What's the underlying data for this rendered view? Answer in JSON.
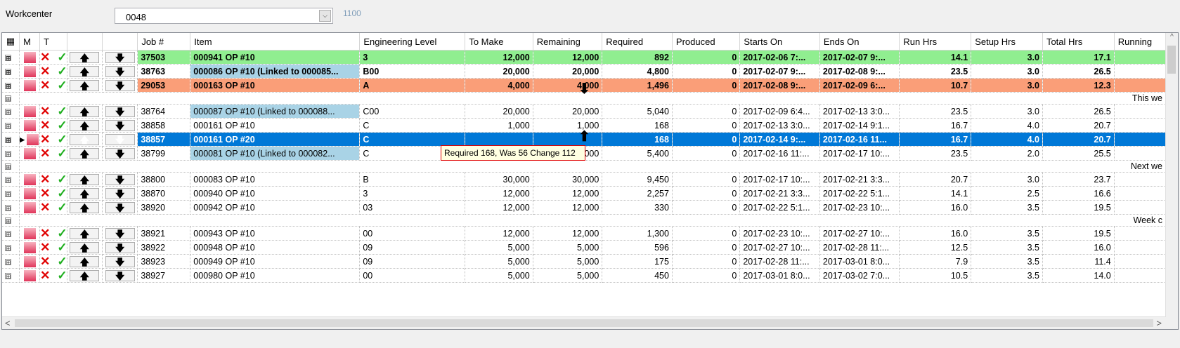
{
  "workcenter": {
    "label": "Workcenter",
    "value": "0048",
    "dropdown_icon": "chevron-down-icon",
    "sub_value": "1100"
  },
  "columns": [
    "",
    "M",
    "T",
    "",
    "",
    "Job #",
    "Item",
    "Engineering Level",
    "To Make",
    "Remaining",
    "Required",
    "Produced",
    "Starts On",
    "Ends On",
    "Run Hrs",
    "Setup Hrs",
    "Total Hrs",
    "Running"
  ],
  "rows": [
    {
      "style": "green",
      "job": "37503",
      "item": "000941 OP #10",
      "eng": "3",
      "to_make": "12,000",
      "remaining": "12,000",
      "required": "892",
      "produced": "0",
      "starts": "2017-02-06 7:...",
      "ends": "2017-02-07 9:...",
      "run": "14.1",
      "setup": "3.0",
      "total": "17.1"
    },
    {
      "style": "white-b",
      "job": "38763",
      "item": "000086 OP #10 (Linked to 000085...",
      "eng": "B00",
      "to_make": "20,000",
      "remaining": "20,000",
      "required": "4,800",
      "produced": "0",
      "starts": "2017-02-07 9:...",
      "ends": "2017-02-08 9:...",
      "run": "23.5",
      "setup": "3.0",
      "total": "26.5",
      "linked": true
    },
    {
      "style": "orange",
      "job": "29053",
      "item": "000163 OP #10",
      "eng": "A",
      "to_make": "4,000",
      "remaining": "4,000",
      "required": "1,496",
      "produced": "0",
      "starts": "2017-02-08 9:...",
      "ends": "2017-02-09 6:...",
      "run": "10.7",
      "setup": "3.0",
      "total": "12.3"
    },
    {
      "group": "This we"
    },
    {
      "style": "",
      "job": "38764",
      "item": "000087 OP #10 (Linked to 000088...",
      "eng": "C00",
      "to_make": "20,000",
      "remaining": "20,000",
      "required": "5,040",
      "produced": "0",
      "starts": "2017-02-09 6:4...",
      "ends": "2017-02-13 3:0...",
      "run": "23.5",
      "setup": "3.0",
      "total": "26.5",
      "linked": true
    },
    {
      "style": "",
      "job": "38858",
      "item": "000161 OP #10",
      "eng": "C",
      "to_make": "1,000",
      "remaining": "1,000",
      "required": "168",
      "produced": "0",
      "starts": "2017-02-13 3:0...",
      "ends": "2017-02-14 9:1...",
      "run": "16.7",
      "setup": "4.0",
      "total": "20.7"
    },
    {
      "style": "sel",
      "job": "38857",
      "item": "000161 OP #20",
      "eng": "C",
      "to_make": "",
      "remaining": "",
      "required": "168",
      "produced": "0",
      "starts": "2017-02-14 9:...",
      "ends": "2017-02-16 11...",
      "run": "16.7",
      "setup": "4.0",
      "total": "20.7",
      "current": true
    },
    {
      "style": "",
      "job": "38799",
      "item": "000081 OP #10 (Linked to 000082...",
      "eng": "C",
      "to_make": "20,000",
      "remaining": "20,000",
      "required": "5,400",
      "produced": "0",
      "starts": "2017-02-16 11:...",
      "ends": "2017-02-17 10:...",
      "run": "23.5",
      "setup": "2.0",
      "total": "25.5",
      "linked": true
    },
    {
      "group": "Next we"
    },
    {
      "style": "",
      "job": "38800",
      "item": "000083 OP #10",
      "eng": "B",
      "to_make": "30,000",
      "remaining": "30,000",
      "required": "9,450",
      "produced": "0",
      "starts": "2017-02-17 10:...",
      "ends": "2017-02-21 3:3...",
      "run": "20.7",
      "setup": "3.0",
      "total": "23.7"
    },
    {
      "style": "",
      "job": "38870",
      "item": "000940 OP #10",
      "eng": "3",
      "to_make": "12,000",
      "remaining": "12,000",
      "required": "2,257",
      "produced": "0",
      "starts": "2017-02-21 3:3...",
      "ends": "2017-02-22 5:1...",
      "run": "14.1",
      "setup": "2.5",
      "total": "16.6"
    },
    {
      "style": "",
      "job": "38920",
      "item": "000942 OP #10",
      "eng": "03",
      "to_make": "12,000",
      "remaining": "12,000",
      "required": "330",
      "produced": "0",
      "starts": "2017-02-22 5:1...",
      "ends": "2017-02-23 10:...",
      "run": "16.0",
      "setup": "3.5",
      "total": "19.5"
    },
    {
      "group": "Week c"
    },
    {
      "style": "",
      "job": "38921",
      "item": "000943 OP #10",
      "eng": "00",
      "to_make": "12,000",
      "remaining": "12,000",
      "required": "1,300",
      "produced": "0",
      "starts": "2017-02-23 10:...",
      "ends": "2017-02-27 10:...",
      "run": "16.0",
      "setup": "3.5",
      "total": "19.5"
    },
    {
      "style": "",
      "job": "38922",
      "item": "000948 OP #10",
      "eng": "09",
      "to_make": "5,000",
      "remaining": "5,000",
      "required": "596",
      "produced": "0",
      "starts": "2017-02-27 10:...",
      "ends": "2017-02-28 11:...",
      "run": "12.5",
      "setup": "3.5",
      "total": "16.0"
    },
    {
      "style": "",
      "job": "38923",
      "item": "000949 OP #10",
      "eng": "09",
      "to_make": "5,000",
      "remaining": "5,000",
      "required": "175",
      "produced": "0",
      "starts": "2017-02-28 11:...",
      "ends": "2017-03-01 8:0...",
      "run": "7.9",
      "setup": "3.5",
      "total": "11.4"
    },
    {
      "style": "",
      "job": "38927",
      "item": "000980 OP #10",
      "eng": "00",
      "to_make": "5,000",
      "remaining": "5,000",
      "required": "450",
      "produced": "0",
      "starts": "2017-03-01 8:0...",
      "ends": "2017-03-02 7:0...",
      "run": "10.5",
      "setup": "3.5",
      "total": "14.0"
    }
  ],
  "tooltip": {
    "text": "Required 168, Was 56 Change 112"
  },
  "icons": {
    "row_delete": "x-icon",
    "row_toggle": "checkmark-icon",
    "move_up": "arrow-up-icon",
    "move_down": "arrow-down-icon",
    "expand": "plus-icon",
    "current_row": "row-pointer-icon",
    "colors": {
      "green": "#90ee90",
      "orange": "#fa9e78",
      "selected": "#0078d7",
      "linked": "#a9d3e6"
    }
  },
  "glyphs": {
    "expand": "⊞",
    "x": "✕",
    "tick": "✓",
    "up": "🡅",
    "down": "🡇",
    "pointer": "▶",
    "scroll_up": "^",
    "scroll_left": "<",
    "scroll_right": ">",
    "chevron": "⌵",
    "big_down": "⬇",
    "big_up": "⬆",
    "grid_menu": "▦"
  }
}
